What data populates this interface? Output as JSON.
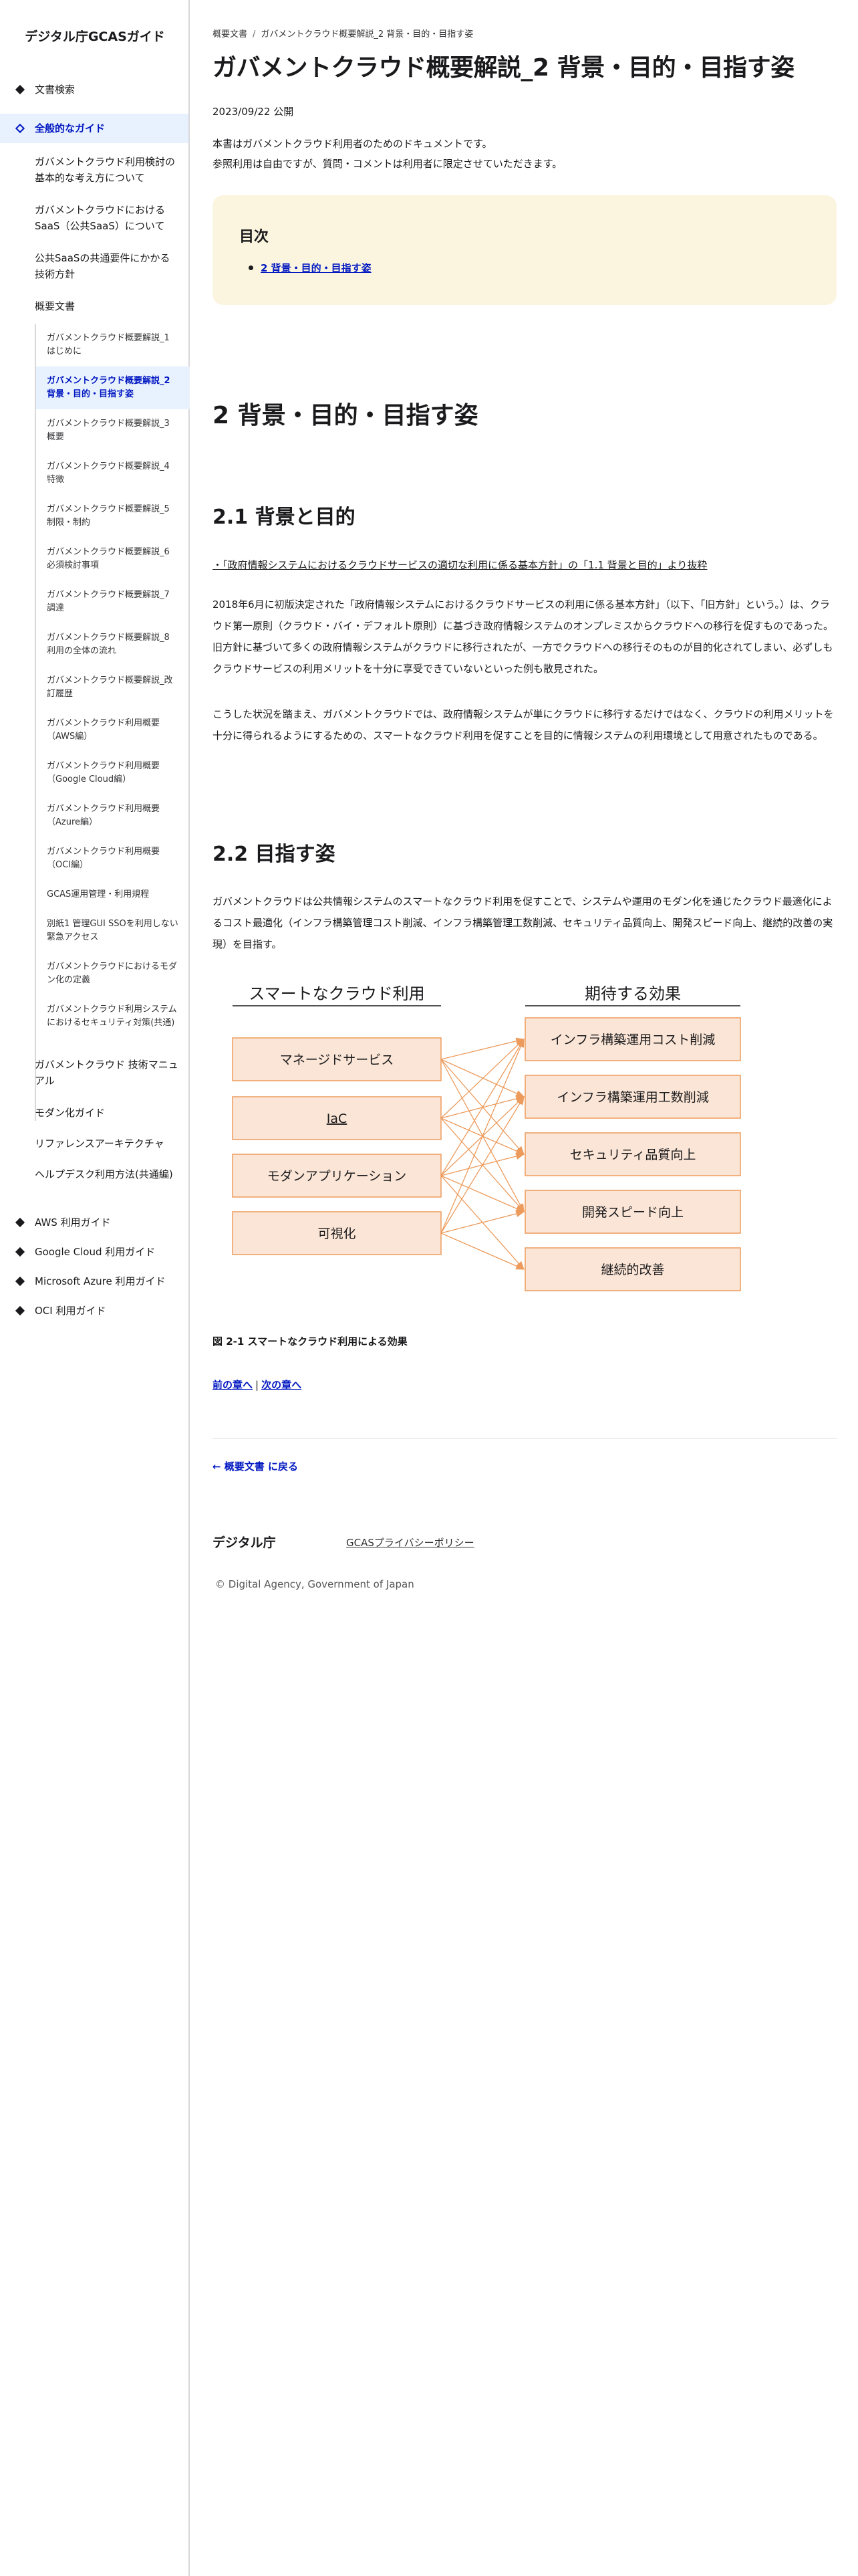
{
  "site": {
    "title": "デジタル庁GCASガイド"
  },
  "sidebar": {
    "top": [
      {
        "label": "文書検索"
      },
      {
        "label": "全般的なガイド"
      }
    ],
    "general_children": [
      {
        "label": "ガバメントクラウド利用検討の基本的な考え方について"
      },
      {
        "label": "ガバメントクラウドにおけるSaaS（公共SaaS）について"
      },
      {
        "label": "公共SaaSの共通要件にかかる技術方針"
      },
      {
        "label": "概要文書"
      }
    ],
    "overview_docs": [
      {
        "label": "ガバメントクラウド概要解説_1 はじめに"
      },
      {
        "label": "ガバメントクラウド概要解説_2 背景・目的・目指す姿"
      },
      {
        "label": "ガバメントクラウド概要解説_3 概要"
      },
      {
        "label": "ガバメントクラウド概要解説_4 特徴"
      },
      {
        "label": "ガバメントクラウド概要解説_5 制限・制約"
      },
      {
        "label": "ガバメントクラウド概要解説_6 必須検討事項"
      },
      {
        "label": "ガバメントクラウド概要解説_7 調達"
      },
      {
        "label": "ガバメントクラウド概要解説_8 利用の全体の流れ"
      },
      {
        "label": "ガバメントクラウド概要解説_改訂履歴"
      },
      {
        "label": "ガバメントクラウド利用概要（AWS編）"
      },
      {
        "label": "ガバメントクラウド利用概要（Google Cloud編）"
      },
      {
        "label": "ガバメントクラウド利用概要（Azure編）"
      },
      {
        "label": "ガバメントクラウド利用概要（OCI編）"
      },
      {
        "label": "GCAS運用管理・利用規程"
      },
      {
        "label": "別紙1 管理GUI SSOを利用しない緊急アクセス"
      },
      {
        "label": "ガバメントクラウドにおけるモダン化の定義"
      },
      {
        "label": "ガバメントクラウド利用システムにおけるセキュリティ対策(共通)"
      }
    ],
    "general_more": [
      {
        "label": "ガバメントクラウド 技術マニュアル"
      },
      {
        "label": "モダン化ガイド"
      },
      {
        "label": "リファレンスアーキテクチャ"
      },
      {
        "label": "ヘルプデスク利用方法(共通編)"
      }
    ],
    "bottom": [
      {
        "label": "AWS 利用ガイド"
      },
      {
        "label": "Google Cloud 利用ガイド"
      },
      {
        "label": "Microsoft Azure 利用ガイド"
      },
      {
        "label": "OCI 利用ガイド"
      }
    ]
  },
  "breadcrumb": {
    "parent": "概要文書",
    "current": "ガバメントクラウド概要解説_2 背景・目的・目指す姿"
  },
  "page": {
    "title": "ガバメントクラウド概要解説_2 背景・目的・目指す姿",
    "date": "2023/09/22 公開",
    "intro_1": "本書はガバメントクラウド利用者のためのドキュメントです。",
    "intro_2": "参照利用は自由ですが、質問・コメントは利用者に限定させていただきます。"
  },
  "toc": {
    "title": "目次",
    "items": [
      {
        "label": "2 背景・目的・目指す姿"
      }
    ]
  },
  "content": {
    "h2": "2 背景・目的・目指す姿",
    "h3_1": "2.1 背景と目的",
    "ref": "・「政府情報システムにおけるクラウドサービスの適切な利用に係る基本方針」の「1.1 背景と目的」より抜粋",
    "p1": "2018年6月に初版決定された「政府情報システムにおけるクラウドサービスの利用に係る基本方針」（以下、「旧方針」という。）は、クラウド第一原則（クラウド・バイ・デフォルト原則）に基づき政府情報システムのオンプレミスからクラウドへの移行を促すものであった。旧方針に基づいて多くの政府情報システムがクラウドに移行されたが、一方でクラウドへの移行そのものが目的化されてしまい、必ずしもクラウドサービスの利用メリットを十分に享受できていないといった例も散見された。",
    "p2": "こうした状況を踏まえ、ガバメントクラウドでは、政府情報システムが単にクラウドに移行するだけではなく、クラウドの利用メリットを十分に得られるようにするための、スマートなクラウド利用を促すことを目的に情報システムの利用環境として用意されたものである。",
    "h3_2": "2.2 目指す姿",
    "p3": "ガバメントクラウドは公共情報システムのスマートなクラウド利用を促すことで、システムや運用のモダン化を通じたクラウド最適化によるコスト最適化（インフラ構築管理コスト削減、インフラ構築管理工数削減、セキュリティ品質向上、開発スピード向上、継続的改善の実現）を目指す。"
  },
  "figure": {
    "left_title": "スマートなクラウド利用",
    "right_title": "期待する効果",
    "left_items": [
      "マネージドサービス",
      "IaC",
      "モダンアプリケーション",
      "可視化"
    ],
    "right_items": [
      "インフラ構築運用コスト削減",
      "インフラ構築運用工数削減",
      "セキュリティ品質向上",
      "開発スピード向上",
      "継続的改善"
    ],
    "caption": "図 2-1 スマートなクラウド利用による効果",
    "box_fill": "#fbe5d6",
    "box_border": "#ed9b5c",
    "arrow_color": "#ed9b5c"
  },
  "pager": {
    "prev": "前の章へ",
    "separator": "|",
    "next": "次の章へ"
  },
  "back": {
    "label": "← 概要文書 に戻る"
  },
  "footer": {
    "brand": "デジタル庁",
    "privacy": "GCASプライバシーポリシー",
    "copyright": "© Digital Agency, Government of Japan"
  },
  "colors": {
    "link": "#0017c1",
    "active_bg": "#e8f1fe",
    "toc_bg": "#fbf5e0"
  }
}
